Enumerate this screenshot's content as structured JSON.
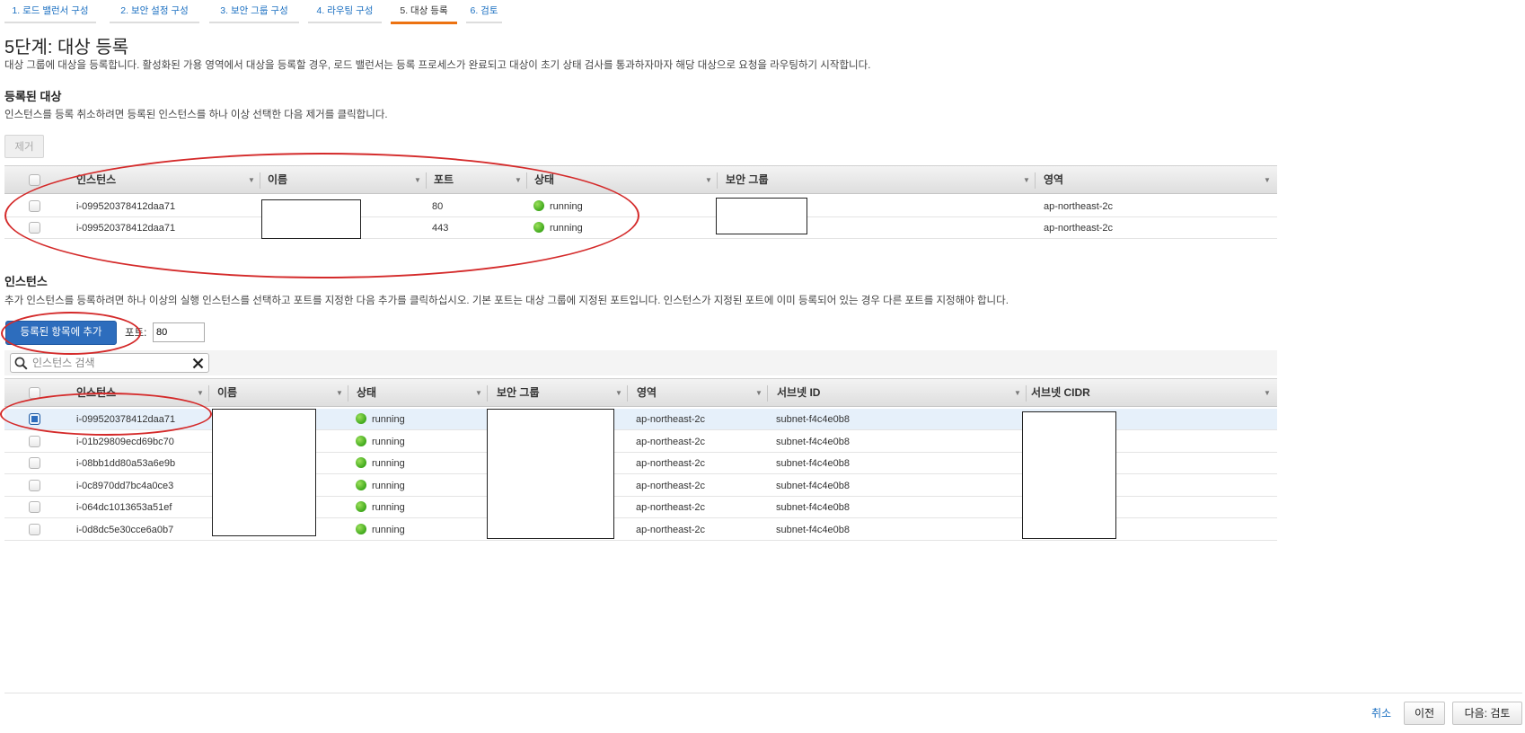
{
  "wizard": {
    "steps": [
      "1. 로드 밸런서 구성",
      "2. 보안 설정 구성",
      "3. 보안 그룹 구성",
      "4. 라우팅 구성",
      "5. 대상 등록",
      "6. 검토"
    ],
    "active_step": 4
  },
  "page": {
    "title": "5단계: 대상 등록",
    "description": "대상 그룹에 대상을 등록합니다. 활성화된 가용 영역에서 대상을 등록할 경우, 로드 밸런서는 등록 프로세스가 완료되고 대상이 초기 상태 검사를 통과하자마자 해당 대상으로 요청을 라우팅하기 시작합니다."
  },
  "registered": {
    "heading": "등록된 대상",
    "description": "인스턴스를 등록 취소하려면 등록된 인스턴스를 하나 이상 선택한 다음 제거를 클릭합니다.",
    "remove_label": "제거",
    "columns": [
      "인스턴스",
      "이름",
      "포트",
      "상태",
      "보안 그룹",
      "영역"
    ],
    "rows": [
      {
        "instance": "i-099520378412daa71",
        "port": "80",
        "state": "running",
        "zone": "ap-northeast-2c"
      },
      {
        "instance": "i-099520378412daa71",
        "port": "443",
        "state": "running",
        "zone": "ap-northeast-2c"
      }
    ]
  },
  "instances": {
    "heading": "인스턴스",
    "description": "추가 인스턴스를 등록하려면 하나 이상의 실행 인스턴스를 선택하고 포트를 지정한 다음 추가를 클릭하십시오. 기본 포트는 대상 그룹에 지정된 포트입니다. 인스턴스가 지정된 포트에 이미 등록되어 있는 경우 다른 포트를 지정해야 합니다.",
    "add_label": "등록된 항목에 추가",
    "port_label": "포트:",
    "port_value": "80",
    "search_placeholder": "인스턴스 검색",
    "columns": [
      "인스턴스",
      "이름",
      "상태",
      "보안 그룹",
      "영역",
      "서브넷 ID",
      "서브넷 CIDR"
    ],
    "rows": [
      {
        "instance": "i-099520378412daa71",
        "state": "running",
        "zone": "ap-northeast-2c",
        "subnet": "subnet-f4c4e0b8",
        "checked": true
      },
      {
        "instance": "i-01b29809ecd69bc70",
        "state": "running",
        "zone": "ap-northeast-2c",
        "subnet": "subnet-f4c4e0b8",
        "checked": false
      },
      {
        "instance": "i-08bb1dd80a53a6e9b",
        "state": "running",
        "zone": "ap-northeast-2c",
        "subnet": "subnet-f4c4e0b8",
        "checked": false
      },
      {
        "instance": "i-0c8970dd7bc4a0ce3",
        "state": "running",
        "zone": "ap-northeast-2c",
        "subnet": "subnet-f4c4e0b8",
        "checked": false
      },
      {
        "instance": "i-064dc1013653a51ef",
        "state": "running",
        "zone": "ap-northeast-2c",
        "subnet": "subnet-f4c4e0b8",
        "checked": false
      },
      {
        "instance": "i-0d8dc5e30cce6a0b7",
        "state": "running",
        "zone": "ap-northeast-2c",
        "subnet": "subnet-f4c4e0b8",
        "checked": false
      }
    ]
  },
  "footer": {
    "cancel_label": "취소",
    "previous_label": "이전",
    "next_label": "다음: 검토"
  },
  "colors": {
    "accent": "#2d6dbd",
    "active_step": "#ec7211",
    "annotation": "#d42a2a",
    "running": "#3fa81c"
  }
}
